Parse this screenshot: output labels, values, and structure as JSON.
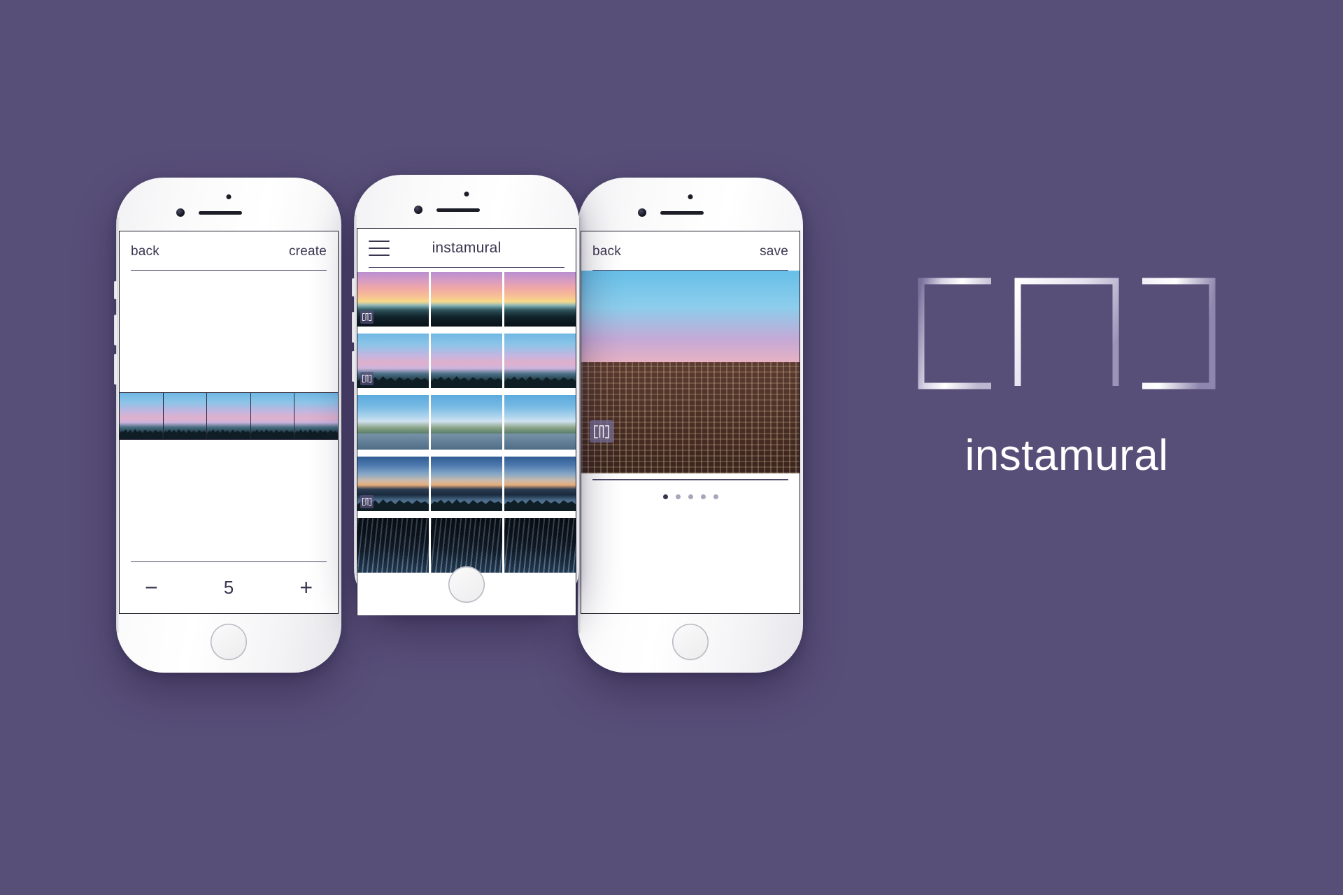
{
  "brand": {
    "name": "instamural",
    "logo_icon": "instamural-bracket-logo",
    "background_color": "#584f79",
    "wordmark_color": "#ffffff"
  },
  "screens": [
    {
      "id": "split-editor",
      "navbar": {
        "left_label": "back",
        "right_label": "create",
        "title": ""
      },
      "stepper": {
        "decrement_label": "−",
        "increment_label": "+",
        "value": "5",
        "segments": 5
      },
      "preview": {
        "scene": "sky-dusk",
        "caption": ""
      }
    },
    {
      "id": "mural-feed",
      "navbar": {
        "menu_icon": "hamburger-icon",
        "title": "instamural",
        "left_label": "",
        "right_label": ""
      },
      "grid": {
        "columns": 3,
        "rows": [
          {
            "scene": "sky-paris",
            "badge": true
          },
          {
            "scene": "sky-dusk",
            "badge": true
          },
          {
            "scene": "sky-hague",
            "badge": false
          },
          {
            "scene": "sky-skyline",
            "badge": true
          },
          {
            "scene": "sky-night",
            "badge": false
          }
        ]
      }
    },
    {
      "id": "mural-detail",
      "navbar": {
        "left_label": "back",
        "right_label": "save",
        "title": ""
      },
      "photo": {
        "scene": "sky-bldg",
        "badge_icon": "instamural-bracket-logo"
      },
      "pager": {
        "total": 5,
        "active_index": 0
      }
    }
  ]
}
